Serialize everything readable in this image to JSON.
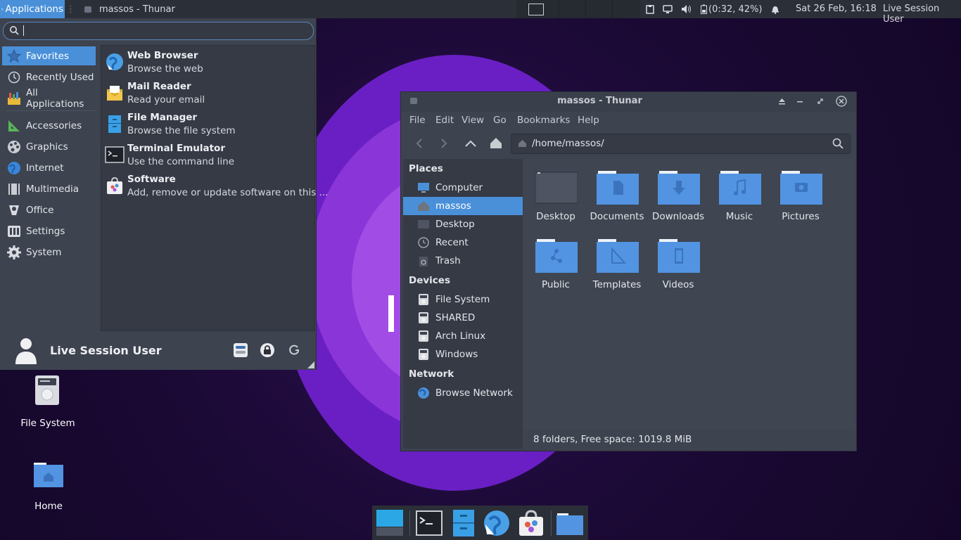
{
  "top_panel": {
    "applications_label": "Applications",
    "window_task_label": "massos - Thunar",
    "battery_text": "(0:32, 42%)",
    "clock": "Sat 26 Feb, 16:18",
    "user": "Live Session User"
  },
  "whisker_menu": {
    "search": {
      "value": "",
      "placeholder": ""
    },
    "categories": [
      {
        "label": "Favorites",
        "selected": true
      },
      {
        "label": "Recently Used"
      },
      {
        "label": "All Applications"
      },
      {
        "label": "Accessories"
      },
      {
        "label": "Graphics"
      },
      {
        "label": "Internet"
      },
      {
        "label": "Multimedia"
      },
      {
        "label": "Office"
      },
      {
        "label": "Settings"
      },
      {
        "label": "System"
      }
    ],
    "apps": [
      {
        "name": "Web Browser",
        "desc": "Browse the web",
        "icon": "web-browser-icon"
      },
      {
        "name": "Mail Reader",
        "desc": "Read your email",
        "icon": "mail-icon"
      },
      {
        "name": "File Manager",
        "desc": "Browse the file system",
        "icon": "file-manager-icon"
      },
      {
        "name": "Terminal Emulator",
        "desc": "Use the command line",
        "icon": "terminal-icon"
      },
      {
        "name": "Software",
        "desc": "Add, remove or update software on this ...",
        "icon": "software-icon"
      }
    ],
    "user_name": "Live Session User"
  },
  "thunar": {
    "title": "massos - Thunar",
    "menu": [
      "File",
      "Edit",
      "View",
      "Go",
      "Bookmarks",
      "Help"
    ],
    "path": "/home/massos/",
    "sections": {
      "places": "Places",
      "devices": "Devices",
      "network": "Network"
    },
    "places": [
      {
        "label": "Computer"
      },
      {
        "label": "massos",
        "selected": true
      },
      {
        "label": "Desktop"
      },
      {
        "label": "Recent"
      },
      {
        "label": "Trash"
      }
    ],
    "devices": [
      {
        "label": "File System"
      },
      {
        "label": "SHARED"
      },
      {
        "label": "Arch Linux"
      },
      {
        "label": "Windows"
      }
    ],
    "network": [
      {
        "label": "Browse Network"
      }
    ],
    "folders": [
      "Desktop",
      "Documents",
      "Downloads",
      "Music",
      "Pictures",
      "Public",
      "Templates",
      "Videos"
    ],
    "status": "8 folders, Free space: 1019.8 MiB"
  },
  "desktop_icons": [
    {
      "label": "File System"
    },
    {
      "label": "Home"
    }
  ],
  "colors": {
    "accent": "#4a90d9",
    "panel": "#2b2f38",
    "window": "#3d434f",
    "folder": "#5294e2"
  }
}
